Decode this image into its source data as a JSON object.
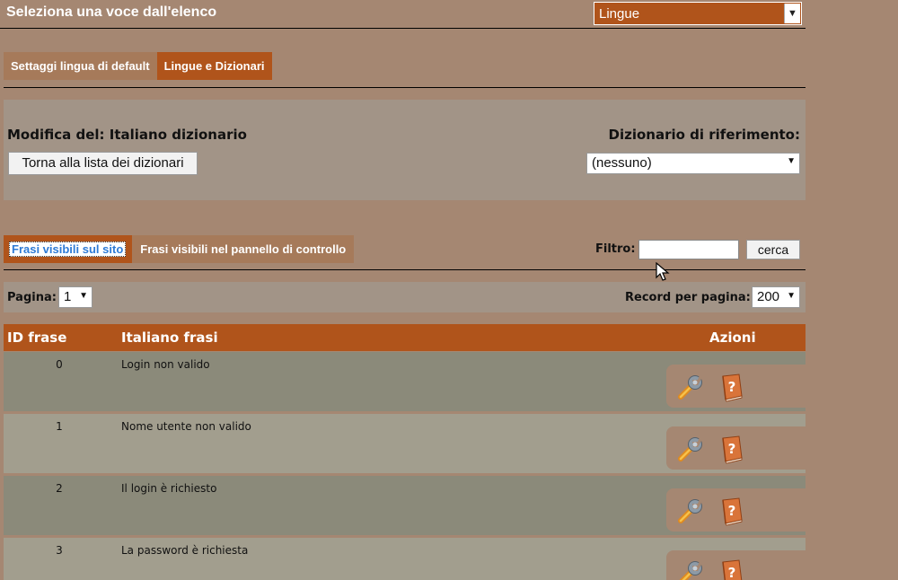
{
  "header": {
    "title": "Seleziona una voce dall'elenco",
    "select_value": "Lingue"
  },
  "tabs_top": [
    {
      "label": "Settaggi lingua di default",
      "active": false
    },
    {
      "label": "Lingue e Dizionari",
      "active": true
    }
  ],
  "dictionary": {
    "title": "Modifica del: Italiano dizionario",
    "back_button": "Torna alla lista dei dizionari",
    "reference_label": "Dizionario di riferimento:",
    "reference_value": "(nessuno)"
  },
  "phrase_tabs": [
    {
      "label": "Frasi visibili sul sito",
      "active": true
    },
    {
      "label": "Frasi visibili nel pannello di controllo",
      "active": false
    }
  ],
  "filter": {
    "label": "Filtro:",
    "value": "",
    "search_button": "cerca"
  },
  "pagination": {
    "page_label": "Pagina:",
    "page_value": "1",
    "records_label": "Record per pagina:",
    "records_value": "200"
  },
  "table": {
    "headers": {
      "id": "ID frase",
      "phrase": "Italiano frasi",
      "actions": "Azioni"
    },
    "rows": [
      {
        "id": "0",
        "phrase": "Login non valido"
      },
      {
        "id": "1",
        "phrase": "Nome utente non valido"
      },
      {
        "id": "2",
        "phrase": "Il login è richiesto"
      },
      {
        "id": "3",
        "phrase": "La password è richiesta"
      }
    ]
  },
  "icons": {
    "edit": "wrench-icon",
    "help": "help-book-icon",
    "dropdown": "chevron-down-icon",
    "cursor": "mouse-cursor-icon"
  },
  "colors": {
    "page_bg": "#a58772",
    "accent": "#b0541b",
    "tab_inactive": "#a67a5a",
    "panel": "#a29487",
    "row_odd": "#8b8a7a",
    "row_even": "#a29e8e",
    "link_blue": "#2e7bd6"
  }
}
